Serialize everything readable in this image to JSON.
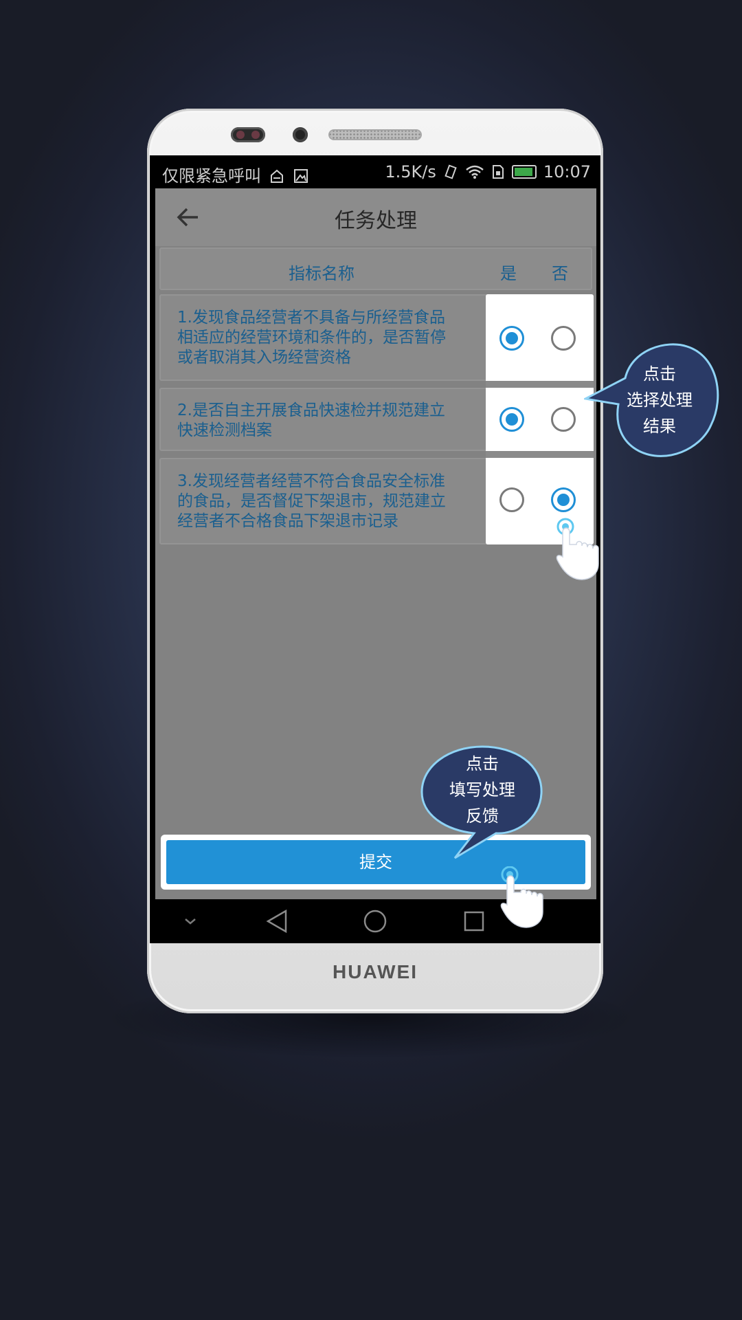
{
  "status_bar": {
    "left_text": "仅限紧急呼叫",
    "net_speed": "1.5K/s",
    "time": "10:07"
  },
  "header": {
    "title": "任务处理"
  },
  "table": {
    "col_name": "指标名称",
    "col_yes": "是",
    "col_no": "否",
    "rows": [
      {
        "lines": [
          "1.发现食品经营者不具备与所经营食品",
          "相适应的经营环境和条件的，是否暂停",
          "或者取消其入场经营资格"
        ],
        "selected": "是"
      },
      {
        "lines": [
          "2.是否自主开展食品快速检并规范建立",
          "快速检测档案"
        ],
        "selected": "是"
      },
      {
        "lines": [
          "3.发现经营者经营不符合食品安全标准",
          "的食品，是否督促下架退市，规范建立",
          "经营者不合格食品下架退市记录"
        ],
        "selected": "否"
      }
    ]
  },
  "submit": {
    "label": "提交"
  },
  "device": {
    "brand": "HUAWEI"
  },
  "callouts": {
    "select": [
      "点击",
      "选择处理",
      "结果"
    ],
    "submit": [
      "点击",
      "填写处理",
      "反馈"
    ]
  },
  "colors": {
    "accent": "#2191d6",
    "text_blue": "#1a5f8f",
    "bubble_fill": "#2a3a66",
    "bubble_outline": "#8fd3f5"
  },
  "icons": [
    "back-arrow-icon",
    "sim-icon",
    "image-icon",
    "vibrate-icon",
    "wifi-icon",
    "sim-card-icon",
    "battery-icon",
    "collapse-icon",
    "back-triangle-icon",
    "home-circle-icon",
    "recents-square-icon"
  ]
}
